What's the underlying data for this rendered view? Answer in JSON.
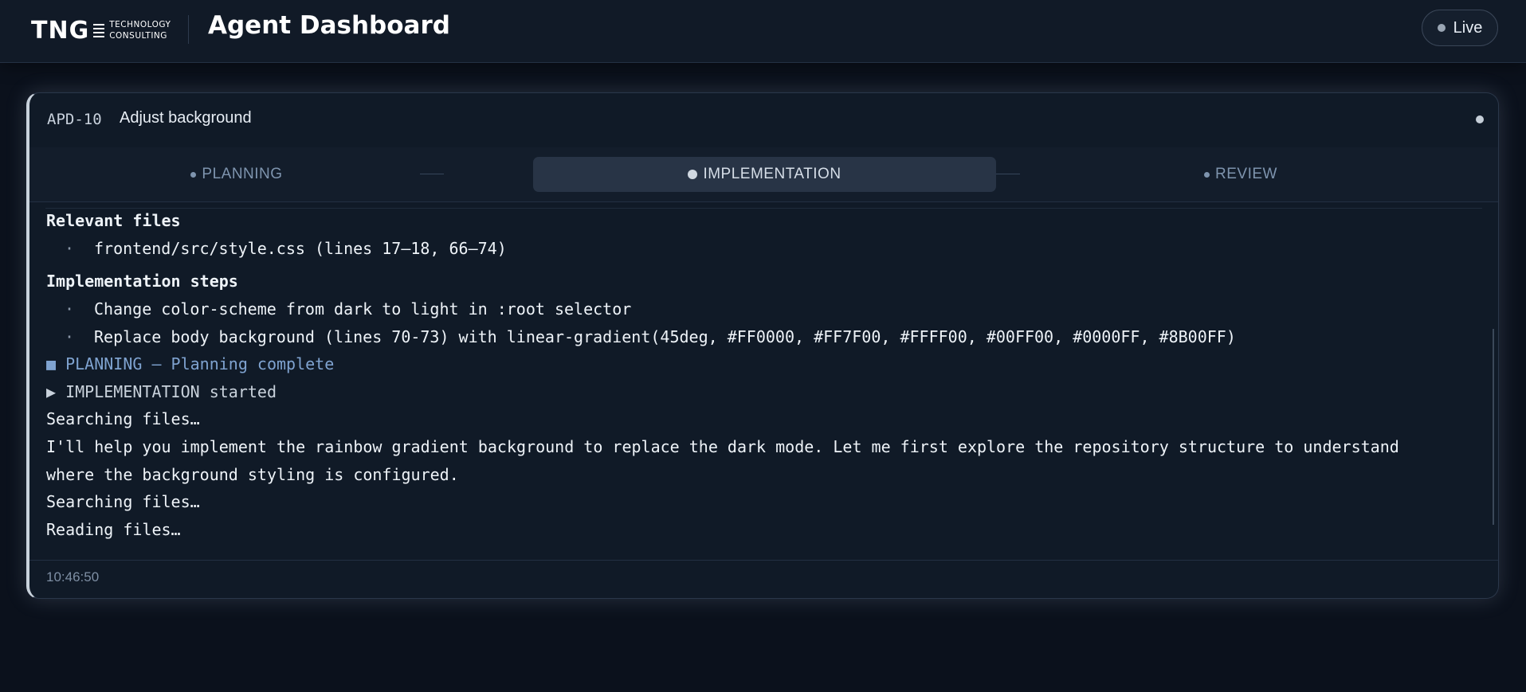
{
  "header": {
    "logo_main": "TNG",
    "logo_sub_1": "TECHNOLOGY",
    "logo_sub_2": "CONSULTING",
    "title": "Agent Dashboard",
    "live_label": "Live"
  },
  "card": {
    "ticket_id": "APD-10",
    "ticket_title": "Adjust background",
    "steps": [
      {
        "label": "PLANNING",
        "state": "inactive"
      },
      {
        "label": "IMPLEMENTATION",
        "state": "active"
      },
      {
        "label": "REVIEW",
        "state": "inactive"
      }
    ],
    "log": {
      "relevant_heading": "Relevant files",
      "relevant_files": [
        "frontend/src/style.css (lines 17–18, 66–74)"
      ],
      "steps_heading": "Implementation steps",
      "steps": [
        "Change color-scheme from dark to light in :root selector",
        "Replace body background (lines 70-73) with linear-gradient(45deg, #FF0000, #FF7F00, #FFFF00, #00FF00, #0000FF, #8B00FF)"
      ],
      "planning_done": "■  PLANNING — Planning complete",
      "impl_started": "▶  IMPLEMENTATION started",
      "searching_1": "Searching files…",
      "message_line_1": "I'll help you implement the rainbow gradient background to replace the dark mode. Let me first explore the repository structure to understand",
      "message_line_2": "where the background styling is configured.",
      "searching_2": "Searching files…",
      "reading": "Reading files…"
    },
    "timestamp": "10:46:50"
  },
  "colors": {
    "background": "#0b111c",
    "card": "#101a27",
    "accent_planning": "#7fa3d0",
    "active_step": "#283446"
  }
}
